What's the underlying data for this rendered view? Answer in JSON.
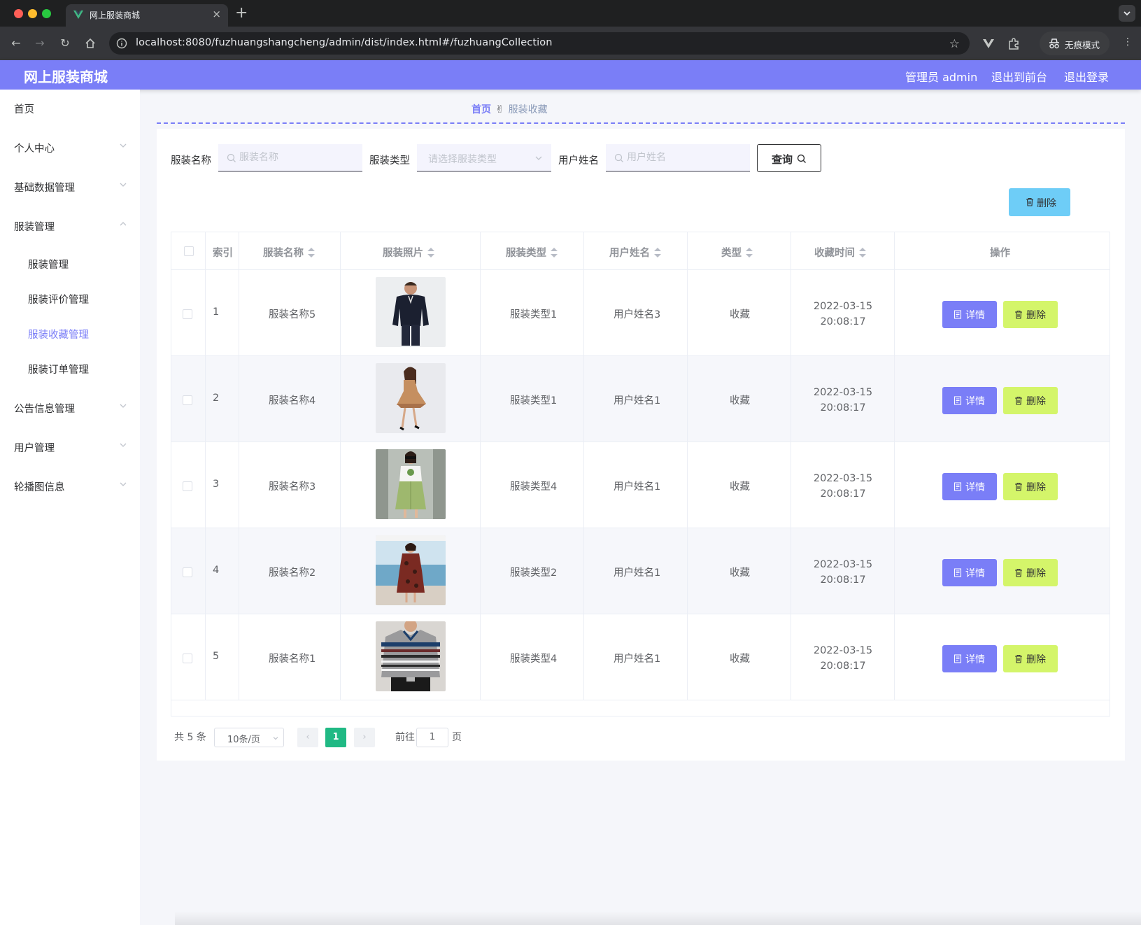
{
  "browser": {
    "tab_title": "网上服装商城",
    "url": "localhost:8080/fuzhuangshangcheng/admin/dist/index.html#/fuzhuangCollection",
    "incognito_label": "无痕模式"
  },
  "header": {
    "brand": "网上服装商城",
    "admin_label": "管理员 admin",
    "to_front": "退出到前台",
    "logout": "退出登录"
  },
  "sidebar": {
    "items": [
      {
        "label": "首页"
      },
      {
        "label": "个人中心"
      },
      {
        "label": "基础数据管理"
      },
      {
        "label": "服装管理"
      },
      {
        "label": "公告信息管理"
      },
      {
        "label": "用户管理"
      },
      {
        "label": "轮播图信息"
      }
    ],
    "sub_items": [
      {
        "label": "服装管理"
      },
      {
        "label": "服装评价管理"
      },
      {
        "label": "服装收藏管理"
      },
      {
        "label": "服装订单管理"
      }
    ]
  },
  "breadcrumb": {
    "home": "首页",
    "separator": "✌",
    "current": "服装收藏"
  },
  "search": {
    "name_label": "服装名称",
    "name_placeholder": "服装名称",
    "type_label": "服装类型",
    "type_placeholder": "请选择服装类型",
    "user_label": "用户姓名",
    "user_placeholder": "用户姓名",
    "query_button": "查询"
  },
  "actions": {
    "bulk_delete": "删除"
  },
  "table": {
    "columns": [
      "索引",
      "服装名称",
      "服装照片",
      "服装类型",
      "用户姓名",
      "类型",
      "收藏时间",
      "操作"
    ],
    "rows": [
      {
        "index": "1",
        "name": "服装名称5",
        "type": "服装类型1",
        "user": "用户姓名3",
        "kind": "收藏",
        "time": "2022-03-15 20:08:17"
      },
      {
        "index": "2",
        "name": "服装名称4",
        "type": "服装类型1",
        "user": "用户姓名1",
        "kind": "收藏",
        "time": "2022-03-15 20:08:17"
      },
      {
        "index": "3",
        "name": "服装名称3",
        "type": "服装类型4",
        "user": "用户姓名1",
        "kind": "收藏",
        "time": "2022-03-15 20:08:17"
      },
      {
        "index": "4",
        "name": "服装名称2",
        "type": "服装类型2",
        "user": "用户姓名1",
        "kind": "收藏",
        "time": "2022-03-15 20:08:17"
      },
      {
        "index": "5",
        "name": "服装名称1",
        "type": "服装类型4",
        "user": "用户姓名1",
        "kind": "收藏",
        "time": "2022-03-15 20:08:17"
      }
    ],
    "detail_label": "详情",
    "delete_label": "删除"
  },
  "pagination": {
    "total": "共 5 条",
    "page_size": "10条/页",
    "current_page": "1",
    "goto_prefix": "前往",
    "goto_value": "1",
    "goto_suffix": "页"
  },
  "colors": {
    "accent": "#7a7ef7",
    "delete_bulk": "#6ecdf7",
    "delete_row": "#d4f56a",
    "pager_active": "#20b984"
  }
}
